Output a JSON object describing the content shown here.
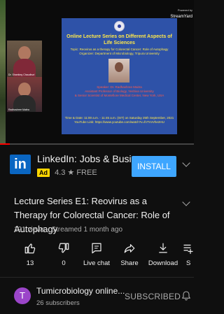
{
  "video": {
    "slide_title": "Online Lecture Series on Different Aspects of Life Sciences",
    "slide_topic": "Topic: Reovirus as a therapy for Colorectal Cancer: Role of Autophagy",
    "slide_organizer": "Organizer: Department of Microbiology, Tripura University",
    "slide_speaker": "Speaker: Dr. Radhashree Maitra",
    "slide_affiliation": "Assistant Professor of Biology, Yeshiva University",
    "slide_affiliation2": "& Senior Scientist of Montefiore Medical Center, New York, USA",
    "slide_time": "Time & Date: 11:00 a.m. - 11:45 a.m. (IST) on Saturday 25th September, 2021",
    "slide_link": "YouTube Link: https://www.youtube.com/watch?v=fnTVvVhe2HU",
    "powered_label": "Powered by",
    "powered_brand": "StreamYard",
    "cam1_name": "Dr. Shantiray Chaudhuri",
    "cam2_name": "Radhashree Maitra",
    "progress_fraction": 0.05
  },
  "ad": {
    "logo": "in",
    "title": "LinkedIn: Jobs & Business...",
    "badge": "Ad",
    "rating": "4.3 ★ FREE",
    "install_label": "INSTALL"
  },
  "info": {
    "title": "Lecture Series E1: Reovirus as a Therapy for Colorectal Cancer: Role of Autophagy",
    "meta": "121 views · Streamed 1 month ago"
  },
  "actions": {
    "like": "13",
    "dislike": "0",
    "chat": "Live chat",
    "share": "Share",
    "download": "Download",
    "save": "S"
  },
  "channel": {
    "avatar_letter": "T",
    "name": "Tumicrobiology online...",
    "subs": "26 subscribers",
    "subscribed_label": "SUBSCRIBED"
  },
  "colors": {
    "accent": "#3ea6ff",
    "linkedin": "#0a66c2",
    "ad_badge": "#ffd600",
    "avatar": "#9b45c9",
    "progress": "#ff0000"
  }
}
